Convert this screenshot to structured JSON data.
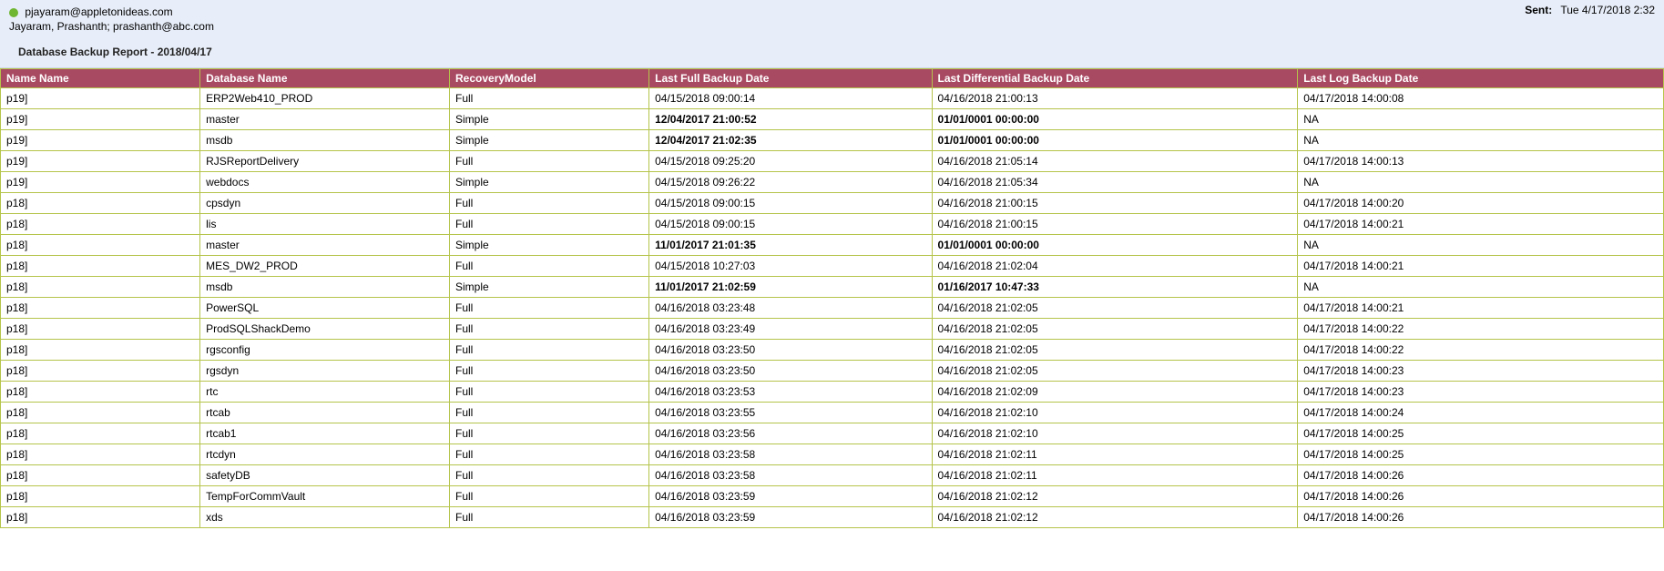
{
  "email": {
    "sender": "pjayaram@appletonideas.com",
    "recipients": "Jayaram, Prashanth; prashanth@abc.com",
    "subject": "Database Backup Report - 2018/04/17",
    "sent_label": "Sent:",
    "sent_value": "Tue 4/17/2018 2:32"
  },
  "report": {
    "headers": [
      "Name Name",
      "Database Name",
      "RecoveryModel",
      "Last Full Backup Date",
      "Last Differential Backup Date",
      "Last Log Backup Date"
    ],
    "rows": [
      {
        "c": [
          "p19]",
          "ERP2Web410_PROD",
          "Full",
          "04/15/2018 09:00:14",
          "04/16/2018 21:00:13",
          "04/17/2018 14:00:08"
        ],
        "a": [
          false,
          false,
          false,
          false,
          false,
          false
        ]
      },
      {
        "c": [
          "p19]",
          "master",
          "Simple",
          "12/04/2017 21:00:52",
          "01/01/0001 00:00:00",
          "NA"
        ],
        "a": [
          false,
          false,
          false,
          true,
          true,
          false
        ]
      },
      {
        "c": [
          "p19]",
          "msdb",
          "Simple",
          "12/04/2017 21:02:35",
          "01/01/0001 00:00:00",
          "NA"
        ],
        "a": [
          false,
          false,
          false,
          true,
          true,
          false
        ]
      },
      {
        "c": [
          "p19]",
          "RJSReportDelivery",
          "Full",
          "04/15/2018 09:25:20",
          "04/16/2018 21:05:14",
          "04/17/2018 14:00:13"
        ],
        "a": [
          false,
          false,
          false,
          false,
          false,
          false
        ]
      },
      {
        "c": [
          "p19]",
          "webdocs",
          "Simple",
          "04/15/2018 09:26:22",
          "04/16/2018 21:05:34",
          "NA"
        ],
        "a": [
          false,
          false,
          false,
          false,
          false,
          false
        ]
      },
      {
        "c": [
          "p18]",
          "cpsdyn",
          "Full",
          "04/15/2018 09:00:15",
          "04/16/2018 21:00:15",
          "04/17/2018 14:00:20"
        ],
        "a": [
          false,
          false,
          false,
          false,
          false,
          false
        ]
      },
      {
        "c": [
          "p18]",
          "lis",
          "Full",
          "04/15/2018 09:00:15",
          "04/16/2018 21:00:15",
          "04/17/2018 14:00:21"
        ],
        "a": [
          false,
          false,
          false,
          false,
          false,
          false
        ]
      },
      {
        "c": [
          "p18]",
          "master",
          "Simple",
          "11/01/2017 21:01:35",
          "01/01/0001 00:00:00",
          "NA"
        ],
        "a": [
          false,
          false,
          false,
          true,
          true,
          false
        ]
      },
      {
        "c": [
          "p18]",
          "MES_DW2_PROD",
          "Full",
          "04/15/2018 10:27:03",
          "04/16/2018 21:02:04",
          "04/17/2018 14:00:21"
        ],
        "a": [
          false,
          false,
          false,
          false,
          false,
          false
        ]
      },
      {
        "c": [
          "p18]",
          "msdb",
          "Simple",
          "11/01/2017 21:02:59",
          "01/16/2017 10:47:33",
          "NA"
        ],
        "a": [
          false,
          false,
          false,
          true,
          true,
          false
        ]
      },
      {
        "c": [
          "p18]",
          "PowerSQL",
          "Full",
          "04/16/2018 03:23:48",
          "04/16/2018 21:02:05",
          "04/17/2018 14:00:21"
        ],
        "a": [
          false,
          false,
          false,
          false,
          false,
          false
        ]
      },
      {
        "c": [
          "p18]",
          "ProdSQLShackDemo",
          "Full",
          "04/16/2018 03:23:49",
          "04/16/2018 21:02:05",
          "04/17/2018 14:00:22"
        ],
        "a": [
          false,
          false,
          false,
          false,
          false,
          false
        ]
      },
      {
        "c": [
          "p18]",
          "rgsconfig",
          "Full",
          "04/16/2018 03:23:50",
          "04/16/2018 21:02:05",
          "04/17/2018 14:00:22"
        ],
        "a": [
          false,
          false,
          false,
          false,
          false,
          false
        ]
      },
      {
        "c": [
          "p18]",
          "rgsdyn",
          "Full",
          "04/16/2018 03:23:50",
          "04/16/2018 21:02:05",
          "04/17/2018 14:00:23"
        ],
        "a": [
          false,
          false,
          false,
          false,
          false,
          false
        ]
      },
      {
        "c": [
          "p18]",
          "rtc",
          "Full",
          "04/16/2018 03:23:53",
          "04/16/2018 21:02:09",
          "04/17/2018 14:00:23"
        ],
        "a": [
          false,
          false,
          false,
          false,
          false,
          false
        ]
      },
      {
        "c": [
          "p18]",
          "rtcab",
          "Full",
          "04/16/2018 03:23:55",
          "04/16/2018 21:02:10",
          "04/17/2018 14:00:24"
        ],
        "a": [
          false,
          false,
          false,
          false,
          false,
          false
        ]
      },
      {
        "c": [
          "p18]",
          "rtcab1",
          "Full",
          "04/16/2018 03:23:56",
          "04/16/2018 21:02:10",
          "04/17/2018 14:00:25"
        ],
        "a": [
          false,
          false,
          false,
          false,
          false,
          false
        ]
      },
      {
        "c": [
          "p18]",
          "rtcdyn",
          "Full",
          "04/16/2018 03:23:58",
          "04/16/2018 21:02:11",
          "04/17/2018 14:00:25"
        ],
        "a": [
          false,
          false,
          false,
          false,
          false,
          false
        ]
      },
      {
        "c": [
          "p18]",
          "safetyDB",
          "Full",
          "04/16/2018 03:23:58",
          "04/16/2018 21:02:11",
          "04/17/2018 14:00:26"
        ],
        "a": [
          false,
          false,
          false,
          false,
          false,
          false
        ]
      },
      {
        "c": [
          "p18]",
          "TempForCommVault",
          "Full",
          "04/16/2018 03:23:59",
          "04/16/2018 21:02:12",
          "04/17/2018 14:00:26"
        ],
        "a": [
          false,
          false,
          false,
          false,
          false,
          false
        ]
      },
      {
        "c": [
          "p18]",
          "xds",
          "Full",
          "04/16/2018 03:23:59",
          "04/16/2018 21:02:12",
          "04/17/2018 14:00:26"
        ],
        "a": [
          false,
          false,
          false,
          false,
          false,
          false
        ]
      }
    ]
  },
  "colwidths": [
    "12%",
    "15%",
    "12%",
    "17%",
    "22%",
    "22%"
  ]
}
